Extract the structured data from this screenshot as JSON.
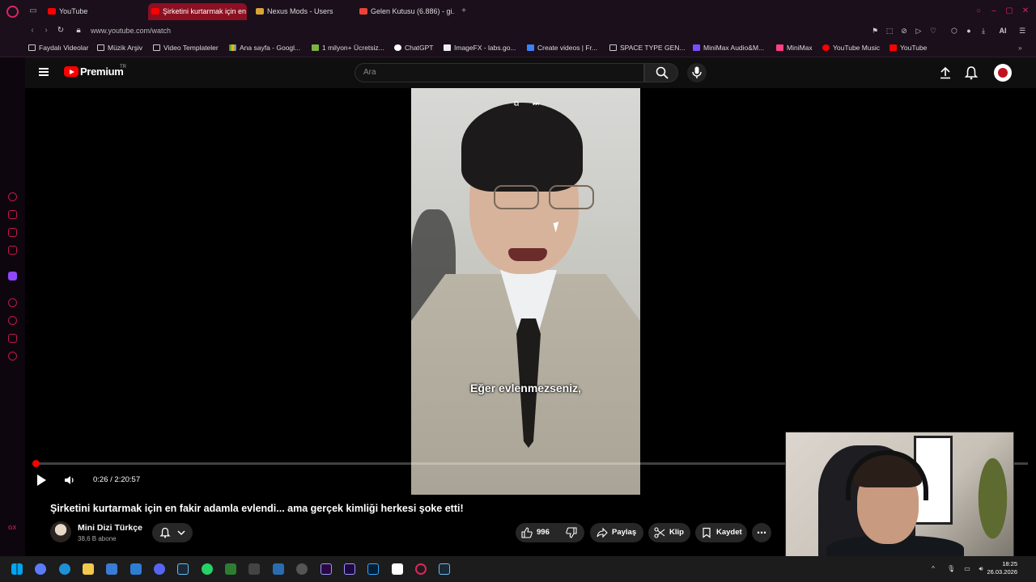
{
  "browser": {
    "tabs": [
      {
        "label": "YouTube",
        "active": false
      },
      {
        "label": "Şirketini kurtarmak için en",
        "active": true
      },
      {
        "label": "Nexus Mods - Users",
        "active": false
      },
      {
        "label": "Gelen Kutusu (6.886) - gi...",
        "active": false
      }
    ],
    "url": "www.youtube.com/watch",
    "ai_label": "AI",
    "bookmarks": [
      "Faydalı Videolar",
      "Müzik Arşiv",
      "Video Templateler",
      "Ana sayfa - Googl...",
      "1 milyon+ Ücretsiz...",
      "ChatGPT",
      "ImageFX - labs.go...",
      "Create videos | Fr...",
      "SPACE TYPE GEN...",
      "MiniMax Audio&M...",
      "MiniMax",
      "YouTube Music",
      "YouTube"
    ]
  },
  "youtube": {
    "brand": "Premium",
    "region": "TR",
    "search_placeholder": "Ara"
  },
  "player": {
    "subtitle": "Eğer evlenmezseniz,",
    "current_time": "0:26 / 2:20:57",
    "progress_fraction": 0.003
  },
  "video": {
    "title": "Şirketini kurtarmak için en fakir adamla evlendi... ama gerçek kimliği herkesi şoke etti!",
    "channel_name": "Mini Dizi Türkçe",
    "subscribers": "38,6 B abone",
    "like_count": "996",
    "share_label": "Paylaş",
    "clip_label": "Klip",
    "save_label": "Kaydet"
  },
  "taskbar": {
    "time": "18:25",
    "date": "26.03.2026"
  },
  "colors": {
    "opera_accent": "#e0245e",
    "youtube_red": "#ff0000",
    "active_tab": "#8b1022"
  }
}
